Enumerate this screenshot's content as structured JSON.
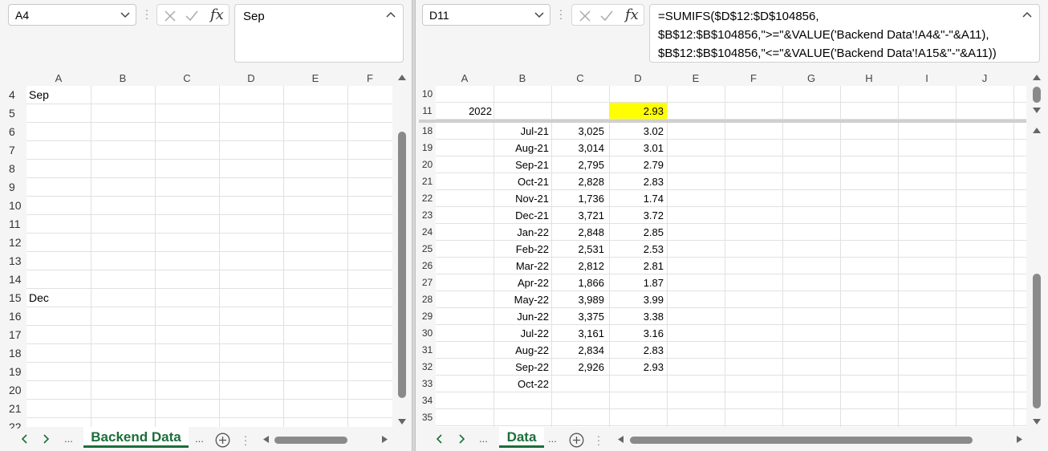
{
  "left": {
    "namebox": "A4",
    "formula": "Sep",
    "columns": [
      "A",
      "B",
      "C",
      "D",
      "E",
      "F"
    ],
    "rows": [
      "4",
      "5",
      "6",
      "7",
      "8",
      "9",
      "10",
      "11",
      "12",
      "13",
      "14",
      "15",
      "16",
      "17",
      "18",
      "19",
      "20",
      "21",
      "22"
    ],
    "cells": {
      "r4": "Sep",
      "r15": "Dec"
    },
    "sheet_tab": "Backend Data",
    "ellipsis": "..."
  },
  "right": {
    "namebox": "D11",
    "formula_lines": [
      "=SUMIFS($D$12:$D$104856,",
      "$B$12:$B$104856,\">=\"&VALUE('Backend Data'!A4&\"-\"&A11),",
      "$B$12:$B$104856,\"<=\"&VALUE('Backend Data'!A15&\"-\"&A11))"
    ],
    "columns": [
      "A",
      "B",
      "C",
      "D",
      "E",
      "F",
      "G",
      "H",
      "I",
      "J"
    ],
    "frozen_rows": [
      {
        "row": "10",
        "a": "",
        "d": ""
      },
      {
        "row": "11",
        "a": "2022",
        "d": "2.93"
      }
    ],
    "rows": [
      {
        "row": "18",
        "b": "Jul-21",
        "c": "3,025",
        "d": "3.02"
      },
      {
        "row": "19",
        "b": "Aug-21",
        "c": "3,014",
        "d": "3.01"
      },
      {
        "row": "20",
        "b": "Sep-21",
        "c": "2,795",
        "d": "2.79"
      },
      {
        "row": "21",
        "b": "Oct-21",
        "c": "2,828",
        "d": "2.83"
      },
      {
        "row": "22",
        "b": "Nov-21",
        "c": "1,736",
        "d": "1.74"
      },
      {
        "row": "23",
        "b": "Dec-21",
        "c": "3,721",
        "d": "3.72"
      },
      {
        "row": "24",
        "b": "Jan-22",
        "c": "2,848",
        "d": "2.85"
      },
      {
        "row": "25",
        "b": "Feb-22",
        "c": "2,531",
        "d": "2.53"
      },
      {
        "row": "26",
        "b": "Mar-22",
        "c": "2,812",
        "d": "2.81"
      },
      {
        "row": "27",
        "b": "Apr-22",
        "c": "1,866",
        "d": "1.87"
      },
      {
        "row": "28",
        "b": "May-22",
        "c": "3,989",
        "d": "3.99"
      },
      {
        "row": "29",
        "b": "Jun-22",
        "c": "3,375",
        "d": "3.38"
      },
      {
        "row": "30",
        "b": "Jul-22",
        "c": "3,161",
        "d": "3.16"
      },
      {
        "row": "31",
        "b": "Aug-22",
        "c": "2,834",
        "d": "2.83"
      },
      {
        "row": "32",
        "b": "Sep-22",
        "c": "2,926",
        "d": "2.93"
      },
      {
        "row": "33",
        "b": "Oct-22",
        "c": "",
        "d": ""
      },
      {
        "row": "34",
        "b": "",
        "c": "",
        "d": ""
      },
      {
        "row": "35",
        "b": "",
        "c": "",
        "d": ""
      }
    ],
    "sheet_tab": "Data",
    "ellipsis": "...",
    "highlight_color": "#ffff00"
  },
  "accent_color": "#1b6e3a"
}
